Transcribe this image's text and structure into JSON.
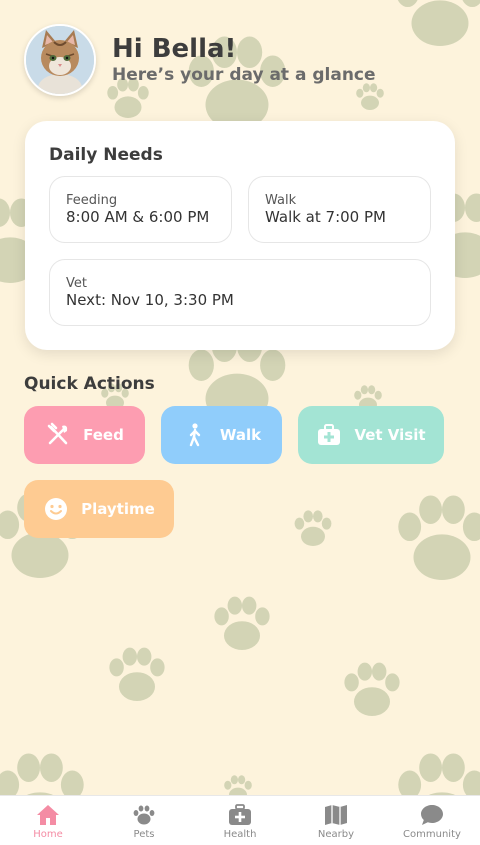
{
  "header": {
    "greeting": "Hi Bella!",
    "subtitle": "Here’s your day at a glance"
  },
  "daily_needs": {
    "title": "Daily Needs",
    "feeding": {
      "label": "Feeding",
      "value": "8:00 AM & 6:00 PM"
    },
    "walk": {
      "label": "Walk",
      "value": "Walk at 7:00 PM"
    },
    "vet": {
      "label": "Vet",
      "value": "Next: Nov 10, 3:30 PM"
    }
  },
  "quick_actions": {
    "title": "Quick Actions",
    "buttons": [
      {
        "label": "Feed",
        "icon": "fork-knife-icon",
        "color": "#fd9db1"
      },
      {
        "label": "Walk",
        "icon": "walking-person-icon",
        "color": "#90cdfb"
      },
      {
        "label": "Vet Visit",
        "icon": "medical-kit-icon",
        "color": "#a3e4d4"
      },
      {
        "label": "Playtime",
        "icon": "smiley-icon",
        "color": "#fecb92"
      }
    ]
  },
  "nav": {
    "items": [
      {
        "label": "Home",
        "icon": "home-icon",
        "active": true
      },
      {
        "label": "Pets",
        "icon": "paw-icon"
      },
      {
        "label": "Health",
        "icon": "medical-kit-icon"
      },
      {
        "label": "Nearby",
        "icon": "map-icon"
      },
      {
        "label": "Community",
        "icon": "chat-bubble-icon"
      }
    ]
  },
  "colors": {
    "background": "#fdf3dc",
    "paw_pattern": "#c5caa9",
    "active_nav": "#f48ca4",
    "inactive_nav": "#8a8a8a"
  }
}
